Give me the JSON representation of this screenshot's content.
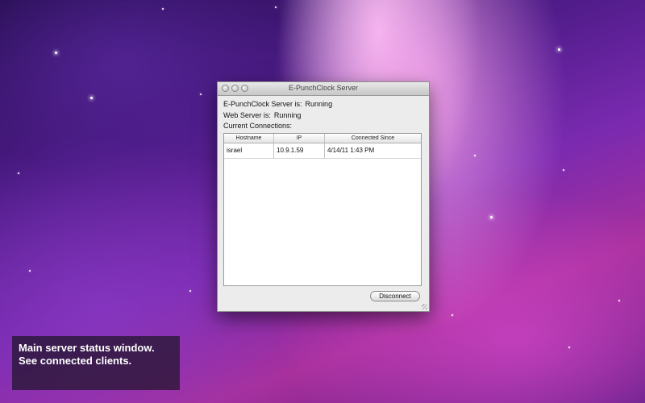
{
  "window": {
    "title": "E-PunchClock Server",
    "server_label": "E-PunchClock Server is:",
    "server_status": "Running",
    "web_label": "Web Server is:",
    "web_status": "Running",
    "connections_label": "Current Connections:",
    "columns": [
      "Hostname",
      "IP",
      "Connected Since"
    ],
    "rows": [
      {
        "hostname": "israel",
        "ip": "10.9.1.59",
        "since": "4/14/11 1:43 PM"
      }
    ],
    "disconnect_label": "Disconnect"
  },
  "caption": {
    "text": "Main server status window. See connected clients."
  }
}
